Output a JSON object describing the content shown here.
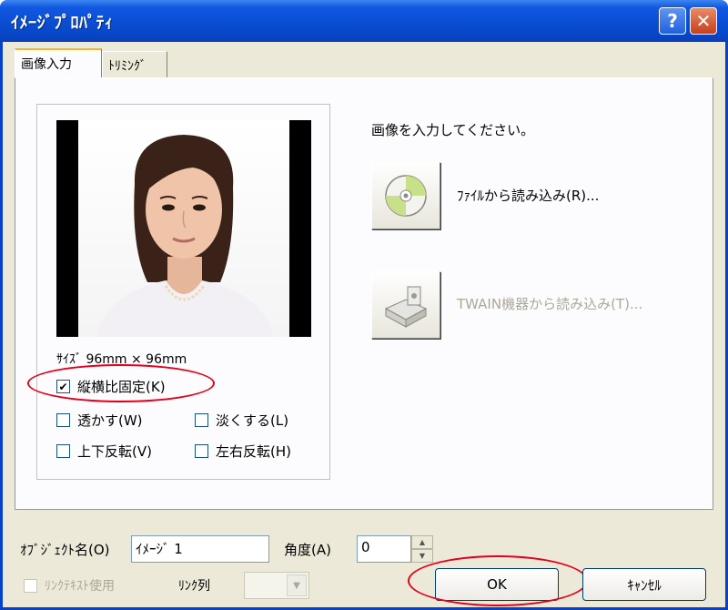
{
  "window": {
    "title": "ｲﾒｰｼﾞﾌﾟﾛﾊﾟﾃｨ",
    "help_label": "?",
    "close_label": "✕"
  },
  "tabs": [
    {
      "label": "画像入力",
      "active": true
    },
    {
      "label": "ﾄﾘﾐﾝｸﾞ",
      "active": false
    }
  ],
  "preview": {
    "size_text": "ｻｲｽﾞ 96mm × 96mm"
  },
  "options": {
    "keep_ratio": {
      "label": "縦横比固定(K)",
      "checked": true
    },
    "transparent": {
      "label": "透かす(W)",
      "checked": false
    },
    "faint": {
      "label": "淡くする(L)",
      "checked": false
    },
    "flip_vertical": {
      "label": "上下反転(V)",
      "checked": false
    },
    "flip_horizontal": {
      "label": "左右反転(H)",
      "checked": false
    }
  },
  "input_section": {
    "instruction": "画像を入力してください。",
    "from_file_label": "ﾌｧｲﾙから読み込み(R)...",
    "from_twain_label": "TWAIN機器から読み込み(T)..."
  },
  "bottom": {
    "object_name_label": "ｵﾌﾞｼﾞｪｸﾄ名(O)",
    "object_name_value": "ｲﾒｰｼﾞ 1",
    "angle_label": "角度(A)",
    "angle_value": "0",
    "link_text_label": "ﾘﾝｸﾃｷｽﾄ使用",
    "link_column_label": "ﾘﾝｸ列",
    "ok_label": "OK",
    "cancel_label": "ｷｬﾝｾﾙ"
  },
  "colors": {
    "titlebar": "#0a4fd6",
    "highlight_ellipse": "#e4001b",
    "face": "#ece9d8"
  }
}
